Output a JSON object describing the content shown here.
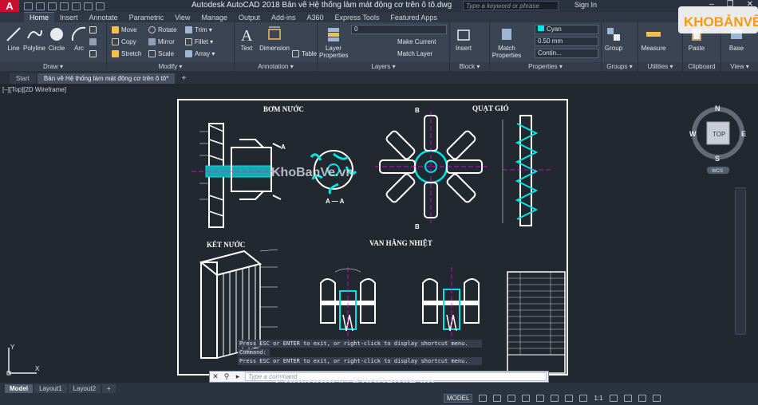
{
  "app": {
    "logo_letter": "A",
    "title": "Autodesk AutoCAD 2018    Bản vẽ Hệ thống làm mát động cơ trên ô tô.dwg",
    "search_placeholder": "Type a keyword or phrase",
    "sign_in": "Sign In",
    "window_controls": [
      "–",
      "❐",
      "✕"
    ]
  },
  "ribbon_tabs": [
    "Home",
    "Insert",
    "Annotate",
    "Parametric",
    "View",
    "Manage",
    "Output",
    "Add-ins",
    "A360",
    "Express Tools",
    "Featured Apps"
  ],
  "ribbon": {
    "draw": {
      "label": "Draw ▾",
      "line": "Line",
      "polyline": "Polyline",
      "circle": "Circle",
      "arc": "Arc"
    },
    "modify": {
      "label": "Modify ▾",
      "move": "Move",
      "rotate": "Rotate",
      "trim": "Trim ▾",
      "copy": "Copy",
      "mirror": "Mirror",
      "fillet": "Fillet ▾",
      "stretch": "Stretch",
      "scale": "Scale",
      "array": "Array ▾"
    },
    "annotation": {
      "label": "Annotation ▾",
      "text": "Text",
      "dimension": "Dimension",
      "table": "Table"
    },
    "layers": {
      "label": "Layers ▾",
      "layer_properties": "Layer Properties",
      "current_layer": "0",
      "make_current": "Make Current",
      "match_layer": "Match Layer"
    },
    "block": {
      "label": "Block ▾",
      "insert": "Insert"
    },
    "properties": {
      "label": "Properties ▾",
      "match_properties": "Match Properties",
      "color": "Cyan",
      "lineweight": "0.50 mm",
      "linetype": "Contin...",
      "color_hex": "#00e5e5"
    },
    "groups": {
      "label": "Groups ▾",
      "group": "Group"
    },
    "utilities": {
      "label": "Utilities ▾",
      "measure": "Measure"
    },
    "clipboard": {
      "label": "Clipboard",
      "paste": "Paste"
    },
    "view": {
      "label": "View ▾",
      "base": "Base"
    }
  },
  "doc_tabs": [
    "Start",
    "Bản vẽ Hệ thống làm mát động cơ trên ô tô*"
  ],
  "viewport": {
    "label": "[–][Top][2D Wireframe]",
    "sheet_titles": {
      "bom_nuoc": "BƠM NƯỚC",
      "quat_gio": "QUẠT GIÓ",
      "ket_nuoc": "KÉT NƯỚC",
      "van_hang_nhiet": "VAN HẰNG NHIỆT",
      "section_aa": "A — A",
      "b_top": "B",
      "b_bottom": "B",
      "a_mark": "A"
    },
    "viewcube": {
      "n": "N",
      "s": "S",
      "e": "E",
      "w": "W",
      "top": "TOP",
      "wcs": "WCS"
    },
    "ucs": {
      "x": "X",
      "y": "Y"
    }
  },
  "command": {
    "history": [
      "Press ESC or ENTER to exit, or right-click to display shortcut menu.",
      "Command:",
      "Press ESC or ENTER to exit, or right-click to display shortcut menu."
    ],
    "placeholder": "Type a command"
  },
  "watermarks": {
    "logo": "KHOBẢNVẼ",
    "center": "KhoBanVe.vn",
    "copyright": "Copyright © KhoBanVe.vn"
  },
  "status": {
    "layouts": [
      "Model",
      "Layout1",
      "Layout2"
    ],
    "model_label": "MODEL",
    "scale": "1:1"
  }
}
